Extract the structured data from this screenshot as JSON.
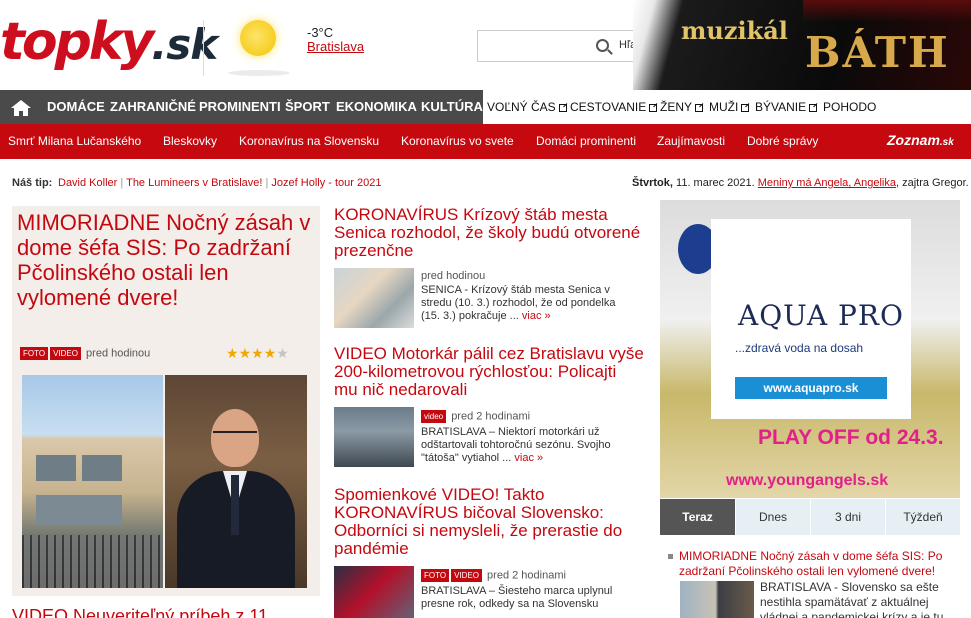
{
  "header": {
    "logo_main": "topky",
    "logo_suffix": ".sk",
    "weather": {
      "temp": "-3°C",
      "city": "Bratislava",
      "icon": "sun-icon"
    },
    "search": {
      "placeholder": "",
      "button": "Hľadaj"
    },
    "banner": {
      "line1": "muzikál",
      "line2": "BÁTH"
    }
  },
  "nav": {
    "home_icon": "home-icon",
    "main": [
      "DOMÁCE",
      "ZAHRANIČNÉ",
      "PROMINENTI",
      "ŠPORT",
      "EKONOMIKA",
      "KULTÚRA"
    ],
    "external": [
      "VOĽNÝ ČAS",
      "CESTOVANIE",
      "ŽENY",
      "MUŽI",
      "BÝVANIE"
    ],
    "last": "POHODO"
  },
  "subnav": {
    "items": [
      "Smrť Milana Lučanského",
      "Bleskovky",
      "Koronavírus na Slovensku",
      "Koronavírus vo svete",
      "Domáci prominenti",
      "Zaujímavosti",
      "Dobré správy"
    ],
    "partner": "Zoznam",
    "partner_suffix": ".sk"
  },
  "tipbar": {
    "label": "Náš tip:",
    "links": [
      "David Koller",
      "The Lumineers v Bratislave!",
      "Jozef Holly - tour 2021"
    ],
    "separator": "|",
    "date": "Štvrtok,",
    "date_rest": " 11. marec 2021. ",
    "nameday": "Meniny má Angela, Angelika",
    "tomorrow": ", zajtra Gregor."
  },
  "featured": {
    "title": "MIMORIADNE Nočný zásah v dome šéfa SIS: Po zadržaní Pčolinského ostali len vylomené dvere!",
    "tags": [
      "FOTO",
      "VIDEO"
    ],
    "time": "pred hodinou",
    "rating": 4,
    "rating_max": 5
  },
  "next_title": "VIDEO Neuveriteľný príbeh z 11.",
  "articles": [
    {
      "title": "KORONAVÍRUS Krízový štáb mesta Senica rozhodol, že školy budú otvorené prezenčne",
      "tags": [],
      "time": "pred hodinou",
      "text": "SENICA - Krízový štáb mesta Senica v stredu (10. 3.) rozhodol, že od pondelka (15. 3.) pokračuje ...",
      "more": "viac »"
    },
    {
      "title": "VIDEO Motorkár pálil cez Bratislavu vyše 200-kilometrovou rýchlosťou: Policajti mu nič nedarovali",
      "tags": [
        "video"
      ],
      "time": "pred 2 hodinami",
      "text": "BRATISLAVA – Niektorí motorkári už odštartovali tohtoročnú sezónu. Svojho \"tátoša\" vytiahol ...",
      "more": "viac »"
    },
    {
      "title": "Spomienkové VIDEO! Takto KORONAVÍRUS bičoval Slovensko: Odborníci si nemysleli, že prerastie do pandémie",
      "tags": [
        "FOTO",
        "VIDEO"
      ],
      "time": "pred 2 hodinami",
      "text": "BRATISLAVA – Šiesteho marca uplynul presne rok, odkedy sa na Slovensku",
      "more": ""
    }
  ],
  "ad_right": {
    "brand": "AQUA PRO",
    "tagline": "...zdravá voda na dosah",
    "button": "www.aquapro.sk",
    "playoff": "PLAY OFF od 24.3.",
    "site": "www.youngangels.sk"
  },
  "top_tabs": [
    "Teraz",
    "Dnes",
    "3 dni",
    "Týždeň"
  ],
  "top_list": {
    "title": "MIMORIADNE Nočný zásah v dome šéfa SIS: Po zadržaní Pčolinského ostali len vylomené dvere!",
    "text": "BRATISLAVA - Slovensko sa ešte nestihla spamätávať z aktuálnej vládnej a pandemickej krízy a je tu"
  },
  "colors": {
    "brand_red": "#c4080f",
    "nav_dark": "#4a4a4a",
    "featured_bg": "#f4eeea"
  }
}
